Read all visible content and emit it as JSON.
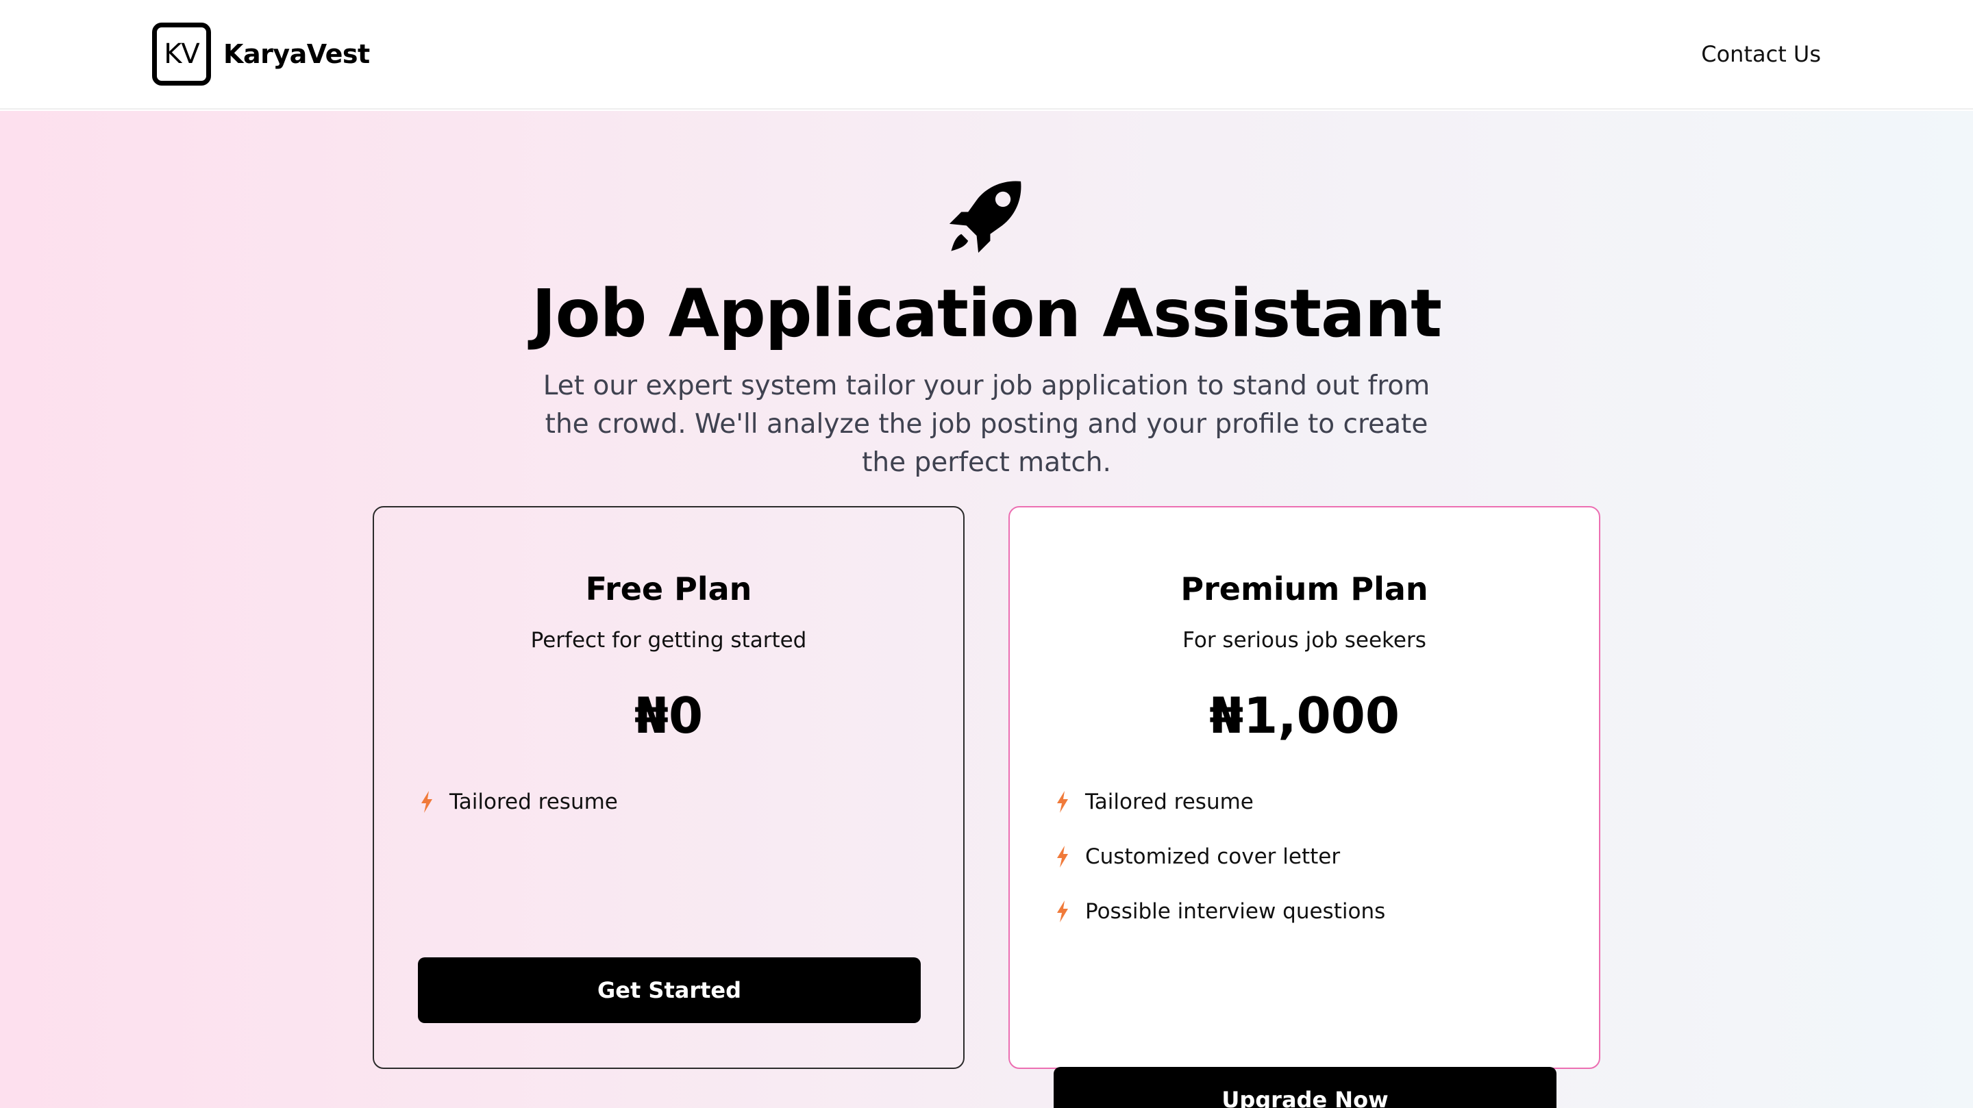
{
  "header": {
    "logo_mark": "KV",
    "brand_name": "KaryaVest",
    "contact_label": "Contact Us"
  },
  "hero": {
    "icon": "rocket-icon",
    "title": "Job Application Assistant",
    "subtitle": "Let our expert system tailor your job application to stand out from the crowd. We'll analyze the job posting and your profile to create the perfect match."
  },
  "plans": [
    {
      "name": "Free Plan",
      "description": "Perfect for getting started",
      "price": "₦0",
      "features": [
        "Tailored resume"
      ],
      "button_label": "Get Started",
      "border_color": "#2b2b2b"
    },
    {
      "name": "Premium Plan",
      "description": "For serious job seekers",
      "price": "₦1,000",
      "features": [
        "Tailored resume",
        "Customized cover letter",
        "Possible interview questions"
      ],
      "button_label": "Upgrade Now",
      "border_color": "#ec6fb2"
    }
  ],
  "colors": {
    "accent_pink": "#ec6fb2",
    "feature_icon": "#f07a3a",
    "button_bg": "#000000",
    "button_text": "#ffffff"
  }
}
